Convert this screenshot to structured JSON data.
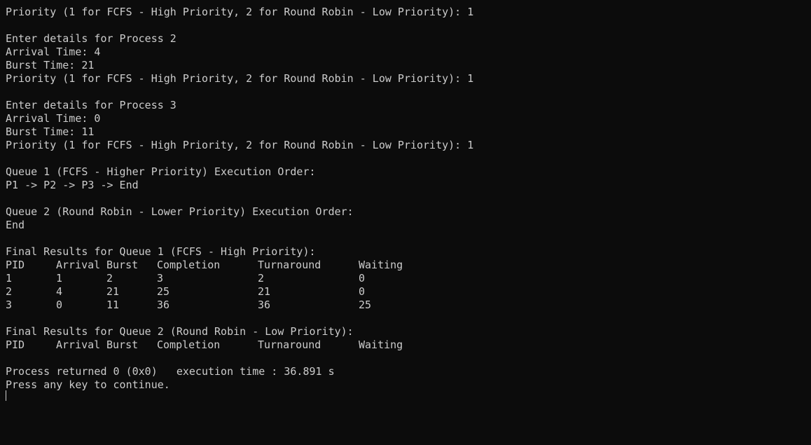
{
  "console": {
    "block1": {
      "priority": "Priority (1 for FCFS - High Priority, 2 for Round Robin - Low Priority): 1"
    },
    "block2": {
      "header": "Enter details for Process 2",
      "arrival": "Arrival Time: 4",
      "burst": "Burst Time: 21",
      "priority": "Priority (1 for FCFS - High Priority, 2 for Round Robin - Low Priority): 1"
    },
    "block3": {
      "header": "Enter details for Process 3",
      "arrival": "Arrival Time: 0",
      "burst": "Burst Time: 11",
      "priority": "Priority (1 for FCFS - High Priority, 2 for Round Robin - Low Priority): 1"
    },
    "queue1_order": {
      "title": "Queue 1 (FCFS - Higher Priority) Execution Order:",
      "order": "P1 -> P2 -> P3 -> End"
    },
    "queue2_order": {
      "title": "Queue 2 (Round Robin - Lower Priority) Execution Order:",
      "order": "End"
    },
    "results_q1": {
      "title": "Final Results for Queue 1 (FCFS - High Priority):",
      "headers": [
        "PID",
        "Arrival",
        "Burst",
        "Completion",
        "Turnaround",
        "Waiting"
      ],
      "rows": [
        [
          "1",
          "1",
          "2",
          "3",
          "2",
          "0"
        ],
        [
          "2",
          "4",
          "21",
          "25",
          "21",
          "0"
        ],
        [
          "3",
          "0",
          "11",
          "36",
          "36",
          "25"
        ]
      ]
    },
    "results_q2": {
      "title": "Final Results for Queue 2 (Round Robin - Low Priority):",
      "headers": [
        "PID",
        "Arrival",
        "Burst",
        "Completion",
        "Turnaround",
        "Waiting"
      ]
    },
    "footer": {
      "process_returned": "Process returned 0 (0x0)   execution time : 36.891 s",
      "press_key": "Press any key to continue."
    }
  }
}
